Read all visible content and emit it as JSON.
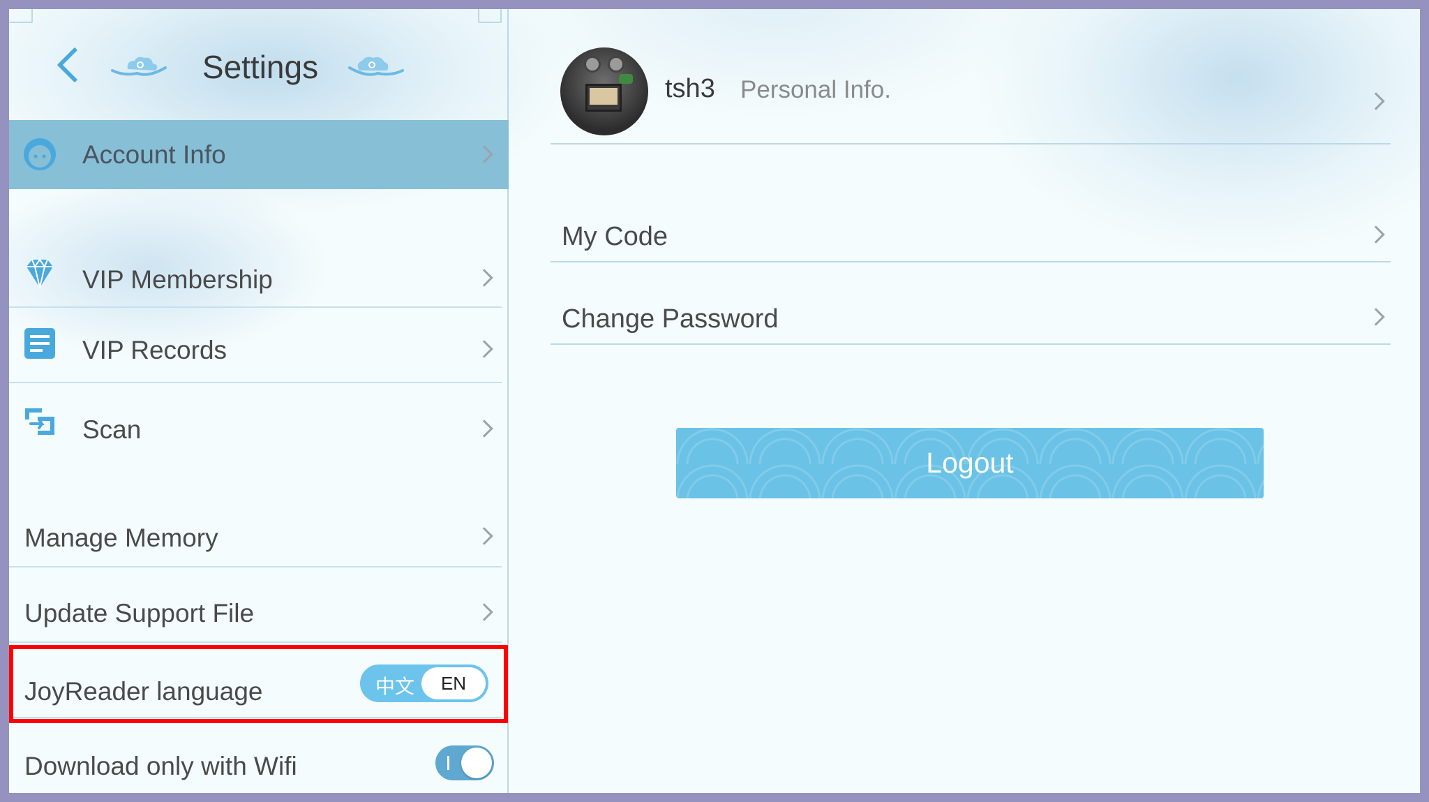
{
  "header": {
    "title": "Settings"
  },
  "sidebar": {
    "items": [
      {
        "label": "Account Info",
        "icon": "face-icon"
      },
      {
        "label": "VIP Membership",
        "icon": "diamond-icon"
      },
      {
        "label": "VIP Records",
        "icon": "document-icon"
      },
      {
        "label": "Scan",
        "icon": "scan-icon"
      },
      {
        "label": "Manage Memory"
      },
      {
        "label": "Update Support File"
      },
      {
        "label": "JoyReader language"
      },
      {
        "label": "Download only with Wifi"
      }
    ],
    "language_toggle": {
      "option_zh": "中文",
      "option_en": "EN",
      "selected": "EN"
    },
    "wifi_toggle": {
      "on": true,
      "indicator": "I"
    }
  },
  "profile": {
    "username": "tsh3",
    "link_label": "Personal Info."
  },
  "account_menu": {
    "items": [
      {
        "label": "My Code"
      },
      {
        "label": "Change Password"
      }
    ]
  },
  "logout_label": "Logout",
  "colors": {
    "accent": "#4aa9dc",
    "selected_row": "#87bfd6",
    "logout_button": "#6ac2e6",
    "highlight_box": "#ff0000",
    "frame_border": "#9592c0"
  }
}
